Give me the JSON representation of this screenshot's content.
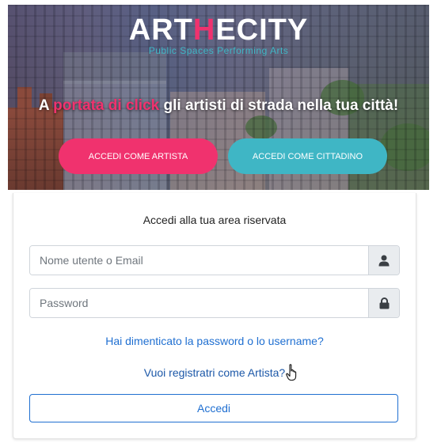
{
  "hero": {
    "logo_left": "ART",
    "logo_mid": "H",
    "logo_right": "ECITY",
    "tagline": "Public Spaces Performing Arts",
    "headline_start": "A ",
    "headline_highlight": "portata di click",
    "headline_end": " gli artisti di strada nella tua città!",
    "artist_button_label": "ACCEDI COME ARTISTA",
    "citizen_button_label": "ACCEDI COME CITTADINO"
  },
  "login": {
    "title": "Accedi alla tua area riservata",
    "username_placeholder": "Nome utente o Email",
    "password_placeholder": "Password",
    "username_icon": "user-icon",
    "password_icon": "lock-icon",
    "forgot_link": "Hai dimenticato la password o lo username?",
    "register_link": "Vuoi registratri come Artista?",
    "submit_label": "Accedi"
  },
  "colors": {
    "pink": "#f0326e",
    "teal": "#3fb6c5",
    "link_blue": "#1f6fd1"
  }
}
